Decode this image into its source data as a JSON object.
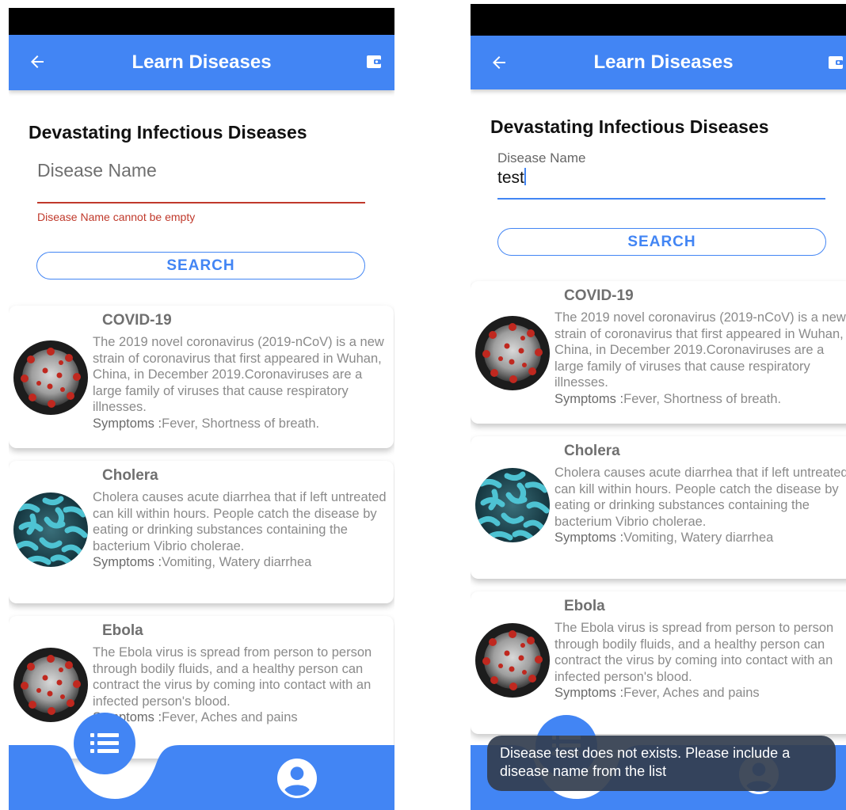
{
  "app": {
    "title": "Learn Diseases",
    "heading": "Devastating Infectious Diseases",
    "accent": "#4285f4",
    "error_color": "#c0392b"
  },
  "search": {
    "label": "Disease Name",
    "placeholder": "Disease Name",
    "error_message": "Disease Name cannot be empty",
    "button_label": "SEARCH",
    "typed_value": "test"
  },
  "diseases": [
    {
      "name": "COVID-19",
      "description": "The 2019 novel coronavirus (2019-nCoV) is a new strain of coronavirus that first appeared in Wuhan, China, in December 2019.Coronaviruses are a large family of viruses that cause respiratory illnesses.",
      "symptoms_label": "Symptoms :",
      "symptoms": "Fever, Shortness of breath.",
      "image": "coronavirus-image"
    },
    {
      "name": "Cholera",
      "description": "Cholera causes acute diarrhea that if left untreated can kill within hours. People catch the disease by eating or drinking substances containing the bacterium Vibrio cholerae.",
      "symptoms_label": "Symptoms :",
      "symptoms": "Vomiting, Watery diarrhea",
      "image": "vibrio-bacteria-image"
    },
    {
      "name": "Ebola",
      "description": "The Ebola virus is spread from person to person through bodily fluids, and a healthy person can contract the virus by coming into contact with an infected person's blood.",
      "symptoms_label": "Symptoms :",
      "symptoms": "Fever, Aches and pains",
      "image": "coronavirus-image"
    }
  ],
  "toast": {
    "message": "Disease test does not exists. Please include a disease name from the list"
  },
  "icons": {
    "back": "arrow-left-icon",
    "wallet": "wallet-icon",
    "list": "list-icon",
    "profile": "account-circle-icon"
  }
}
